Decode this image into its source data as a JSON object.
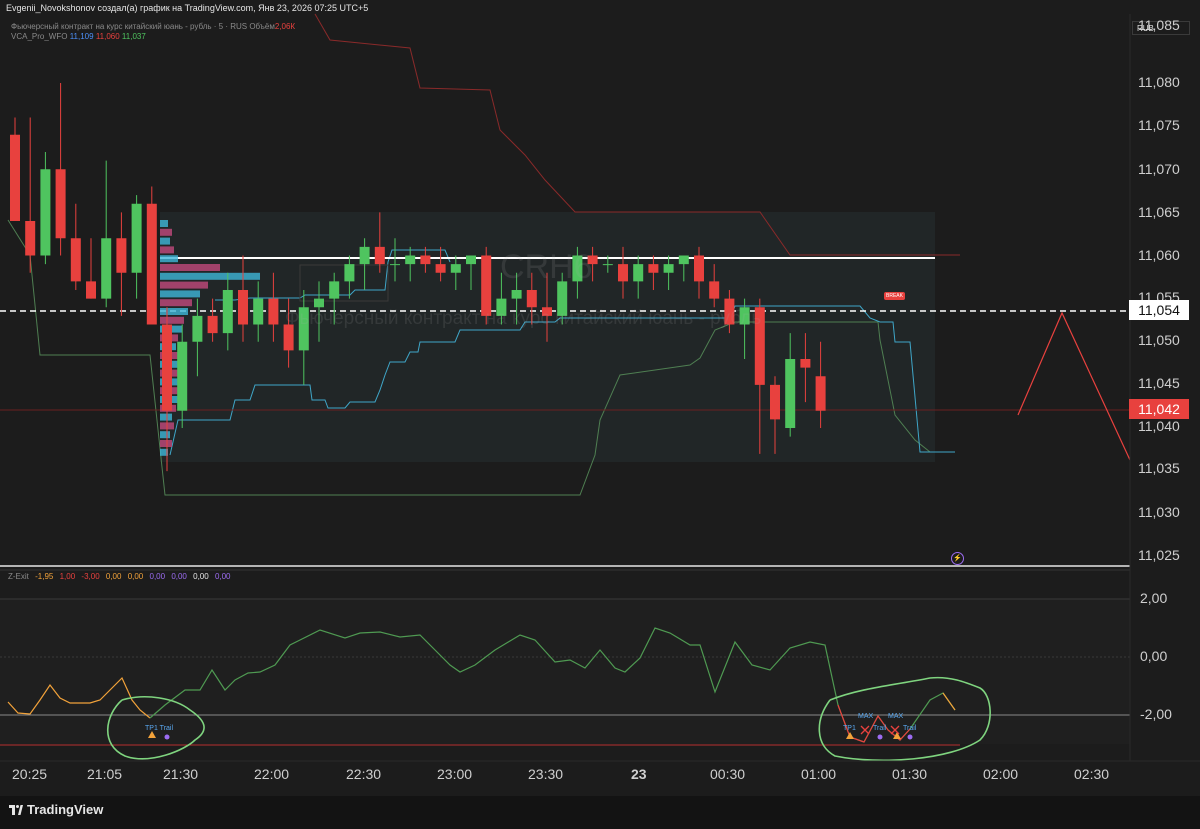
{
  "header": {
    "headline": "Evgenii_Novokshonov создал(а) график на TradingView.com, Янв 23, 2026 07:25 UTC+5",
    "legend_series": "Фьючерсный контракт на курс китайский юань - рубль · 5 · RUS",
    "legend_volume_label": "Объём",
    "legend_volume_value": "2,06К",
    "indicator_name": "VCA_Pro_WFO",
    "indicator_values": [
      "11,109",
      "11,060",
      "11,037"
    ],
    "currency": "RUB"
  },
  "watermark": {
    "symbol": "CRH6",
    "description": "Фьючерсный контракт на курс китайский юань - рубль"
  },
  "price_axis": {
    "ticks": [
      "11,085",
      "11,080",
      "11,075",
      "11,070",
      "11,065",
      "11,060",
      "11,055",
      "11,050",
      "11,045",
      "11,040",
      "11,035",
      "11,030",
      "11,025"
    ],
    "marker_last": "11,054",
    "marker_current": "11,042"
  },
  "oscillator": {
    "name": "Z-Exit",
    "values": [
      "-1,95",
      "1,00",
      "-3,00",
      "0,00",
      "0,00",
      "0,00",
      "0,00",
      "0,00",
      "0,00"
    ],
    "ticks": [
      "2,00",
      "0,00",
      "-2,00"
    ],
    "label_tp1": "TP1",
    "label_trail": "Trail",
    "label_max": "MAX"
  },
  "time_axis": {
    "ticks": [
      "20:25",
      "21:05",
      "21:30",
      "22:00",
      "22:30",
      "23:00",
      "23:30",
      "23",
      "00:30",
      "01:00",
      "01:30",
      "02:00",
      "02:30"
    ]
  },
  "break_label": "BREAK",
  "brand": "TradingView",
  "colors": {
    "up": "#4fc45f",
    "down": "#e8413e",
    "background": "#1c1c1c",
    "profile_cyan": "#3fb6d8",
    "profile_pink": "#c24a7d"
  },
  "chart_data": {
    "type": "candlestick",
    "x_axis": [
      "20:25",
      "21:05",
      "21:30",
      "22:00",
      "22:30",
      "23:00",
      "23:30",
      "23",
      "00:30",
      "01:00",
      "01:30",
      "02:00",
      "02:30"
    ],
    "ylim": [
      11.024,
      11.088
    ],
    "candles": [
      {
        "o": 11.074,
        "h": 11.076,
        "l": 11.064,
        "c": 11.064
      },
      {
        "o": 11.064,
        "h": 11.076,
        "l": 11.058,
        "c": 11.06
      },
      {
        "o": 11.06,
        "h": 11.072,
        "l": 11.059,
        "c": 11.07
      },
      {
        "o": 11.07,
        "h": 11.08,
        "l": 11.06,
        "c": 11.062
      },
      {
        "o": 11.062,
        "h": 11.066,
        "l": 11.056,
        "c": 11.057
      },
      {
        "o": 11.057,
        "h": 11.062,
        "l": 11.055,
        "c": 11.055
      },
      {
        "o": 11.055,
        "h": 11.071,
        "l": 11.054,
        "c": 11.062
      },
      {
        "o": 11.062,
        "h": 11.065,
        "l": 11.053,
        "c": 11.058
      },
      {
        "o": 11.058,
        "h": 11.067,
        "l": 11.055,
        "c": 11.066
      },
      {
        "o": 11.066,
        "h": 11.068,
        "l": 11.052,
        "c": 11.052
      },
      {
        "o": 11.052,
        "h": 11.054,
        "l": 11.035,
        "c": 11.042
      },
      {
        "o": 11.042,
        "h": 11.052,
        "l": 11.04,
        "c": 11.05
      },
      {
        "o": 11.05,
        "h": 11.055,
        "l": 11.046,
        "c": 11.053
      },
      {
        "o": 11.053,
        "h": 11.055,
        "l": 11.05,
        "c": 11.051
      },
      {
        "o": 11.051,
        "h": 11.058,
        "l": 11.049,
        "c": 11.056
      },
      {
        "o": 11.056,
        "h": 11.06,
        "l": 11.05,
        "c": 11.052
      },
      {
        "o": 11.052,
        "h": 11.057,
        "l": 11.05,
        "c": 11.055
      },
      {
        "o": 11.055,
        "h": 11.058,
        "l": 11.05,
        "c": 11.052
      },
      {
        "o": 11.052,
        "h": 11.055,
        "l": 11.047,
        "c": 11.049
      },
      {
        "o": 11.049,
        "h": 11.056,
        "l": 11.045,
        "c": 11.054
      },
      {
        "o": 11.054,
        "h": 11.057,
        "l": 11.05,
        "c": 11.055
      },
      {
        "o": 11.055,
        "h": 11.058,
        "l": 11.052,
        "c": 11.057
      },
      {
        "o": 11.057,
        "h": 11.06,
        "l": 11.055,
        "c": 11.059
      },
      {
        "o": 11.059,
        "h": 11.062,
        "l": 11.056,
        "c": 11.061
      },
      {
        "o": 11.061,
        "h": 11.065,
        "l": 11.058,
        "c": 11.059
      },
      {
        "o": 11.059,
        "h": 11.062,
        "l": 11.057,
        "c": 11.059
      },
      {
        "o": 11.059,
        "h": 11.061,
        "l": 11.057,
        "c": 11.06
      },
      {
        "o": 11.06,
        "h": 11.061,
        "l": 11.058,
        "c": 11.059
      },
      {
        "o": 11.059,
        "h": 11.061,
        "l": 11.057,
        "c": 11.058
      },
      {
        "o": 11.058,
        "h": 11.06,
        "l": 11.056,
        "c": 11.059
      },
      {
        "o": 11.059,
        "h": 11.06,
        "l": 11.056,
        "c": 11.06
      },
      {
        "o": 11.06,
        "h": 11.061,
        "l": 11.052,
        "c": 11.053
      },
      {
        "o": 11.053,
        "h": 11.058,
        "l": 11.052,
        "c": 11.055
      },
      {
        "o": 11.055,
        "h": 11.058,
        "l": 11.052,
        "c": 11.056
      },
      {
        "o": 11.056,
        "h": 11.058,
        "l": 11.052,
        "c": 11.054
      },
      {
        "o": 11.054,
        "h": 11.058,
        "l": 11.05,
        "c": 11.053
      },
      {
        "o": 11.053,
        "h": 11.058,
        "l": 11.052,
        "c": 11.057
      },
      {
        "o": 11.057,
        "h": 11.061,
        "l": 11.055,
        "c": 11.06
      },
      {
        "o": 11.06,
        "h": 11.061,
        "l": 11.057,
        "c": 11.059
      },
      {
        "o": 11.059,
        "h": 11.06,
        "l": 11.058,
        "c": 11.059
      },
      {
        "o": 11.059,
        "h": 11.061,
        "l": 11.055,
        "c": 11.057
      },
      {
        "o": 11.057,
        "h": 11.06,
        "l": 11.055,
        "c": 11.059
      },
      {
        "o": 11.059,
        "h": 11.06,
        "l": 11.056,
        "c": 11.058
      },
      {
        "o": 11.058,
        "h": 11.06,
        "l": 11.056,
        "c": 11.059
      },
      {
        "o": 11.059,
        "h": 11.06,
        "l": 11.057,
        "c": 11.06
      },
      {
        "o": 11.06,
        "h": 11.061,
        "l": 11.055,
        "c": 11.057
      },
      {
        "o": 11.057,
        "h": 11.059,
        "l": 11.054,
        "c": 11.055
      },
      {
        "o": 11.055,
        "h": 11.056,
        "l": 11.051,
        "c": 11.052
      },
      {
        "o": 11.052,
        "h": 11.055,
        "l": 11.048,
        "c": 11.054
      },
      {
        "o": 11.054,
        "h": 11.055,
        "l": 11.037,
        "c": 11.045
      },
      {
        "o": 11.045,
        "h": 11.046,
        "l": 11.037,
        "c": 11.041
      },
      {
        "o": 11.04,
        "h": 11.051,
        "l": 11.039,
        "c": 11.048
      },
      {
        "o": 11.048,
        "h": 11.051,
        "l": 11.043,
        "c": 11.047
      },
      {
        "o": 11.046,
        "h": 11.05,
        "l": 11.04,
        "c": 11.042
      }
    ]
  }
}
